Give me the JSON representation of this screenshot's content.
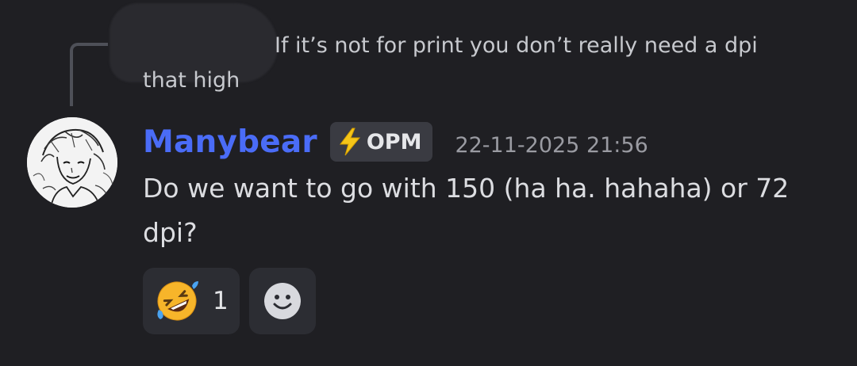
{
  "reply": {
    "text": "If it’s not for print you don’t really need a dpi that high"
  },
  "message": {
    "author": "Manybear",
    "role_tag": "OPM",
    "role_icon": "lightning-bolt-icon",
    "timestamp": "22-11-2025 21:56",
    "text": "Do we want to go with 150 (ha ha. hahaha) or 72 dpi?"
  },
  "reactions": [
    {
      "emoji": "rolling-on-floor-laughing-emoji",
      "count": "1"
    }
  ],
  "colors": {
    "background": "#1f1f23",
    "username": "#4a6cf7",
    "tag_background": "#3a3b42",
    "reaction_background": "#2c2d33",
    "lightning": "#f5c518"
  }
}
